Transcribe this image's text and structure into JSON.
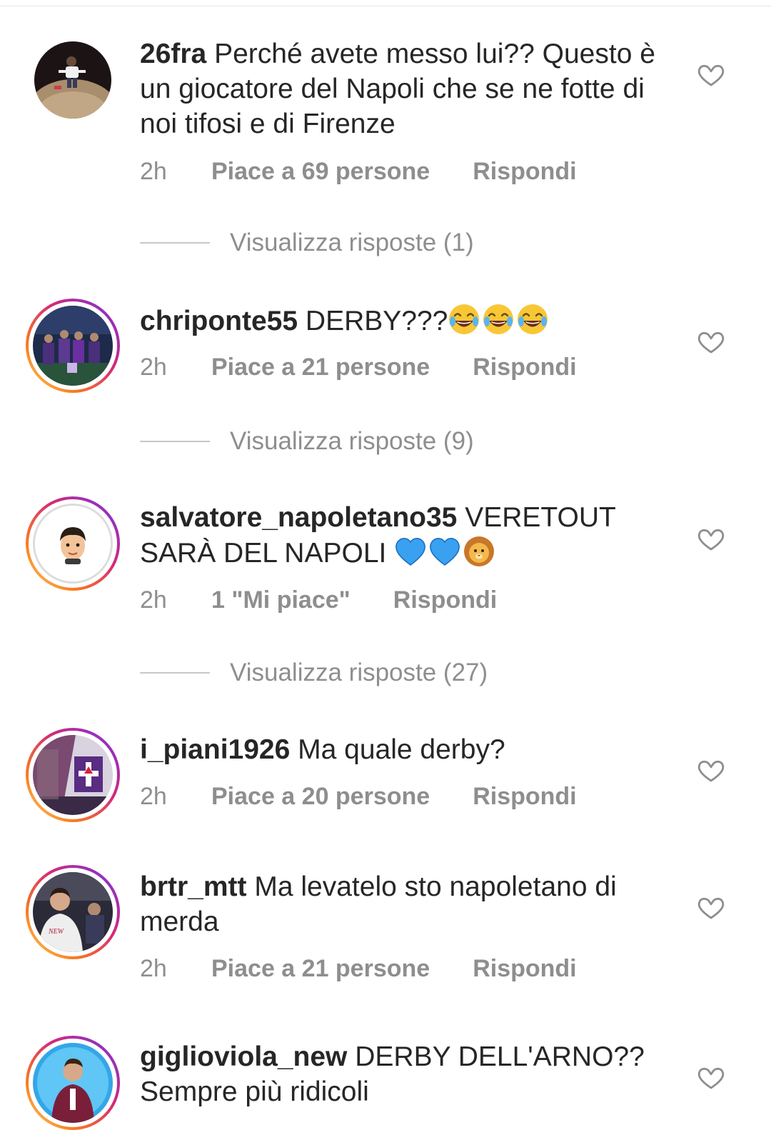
{
  "comments": [
    {
      "username": "26fra",
      "text": "Perché avete messo lui?? Questo è un giocatore del Napoli che se ne fotte di noi tifosi e di Firenze",
      "time": "2h",
      "likes": "Piace a 69 persone",
      "reply": "Rispondi",
      "view_replies": "Visualizza risposte (1)"
    },
    {
      "username": "chriponte55",
      "text": "DERBY???",
      "emojis": [
        "face-with-tears-of-joy",
        "face-with-tears-of-joy",
        "face-with-tears-of-joy"
      ],
      "time": "2h",
      "likes": "Piace a 21 persone",
      "reply": "Rispondi",
      "view_replies": "Visualizza risposte (9)"
    },
    {
      "username": "salvatore_napoletano35",
      "text": "VERETOUT SARÀ DEL NAPOLI",
      "emojis": [
        "light-blue-heart",
        "light-blue-heart",
        "lion-face"
      ],
      "time": "2h",
      "likes": "1 \"Mi piace\"",
      "reply": "Rispondi",
      "view_replies": "Visualizza risposte (27)"
    },
    {
      "username": "i_piani1926",
      "text": "Ma quale derby?",
      "time": "2h",
      "likes": "Piace a 20 persone",
      "reply": "Rispondi"
    },
    {
      "username": "brtr_mtt",
      "text": "Ma levatelo sto napoletano di merda",
      "time": "2h",
      "likes": "Piace a 21 persone",
      "reply": "Rispondi"
    },
    {
      "username": "giglioviola_new",
      "text": "DERBY DELL'ARNO?? Sempre più ridicoli"
    }
  ],
  "icons": {
    "like": "heart-outline-icon"
  },
  "colors": {
    "text": "#262626",
    "secondary": "#8e8e8e",
    "story_ring_start": "#fa7e1e",
    "story_ring_end": "#d62976",
    "emoji_blue_heart": "#3aa0f0",
    "emoji_yellow": "#f8c736"
  }
}
